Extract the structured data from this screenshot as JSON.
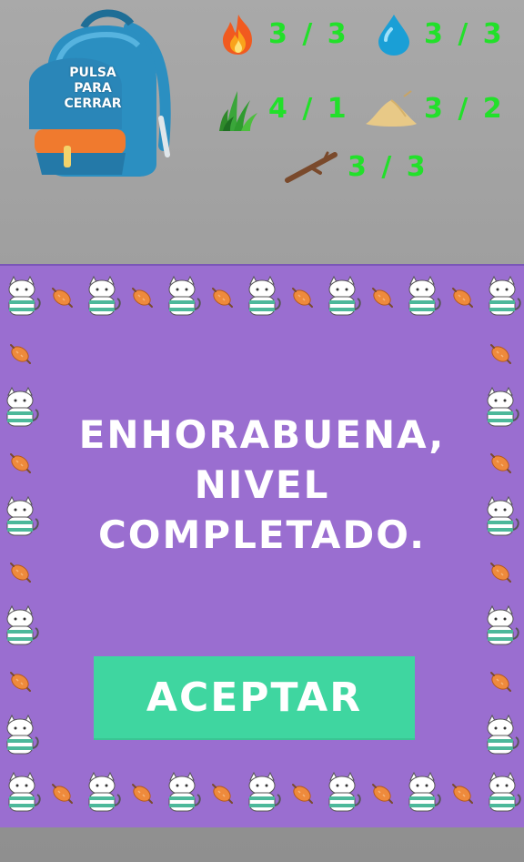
{
  "colors": {
    "panel": "#9a6ed0",
    "counter_text": "#22e02a",
    "accept_button": "#3fd6a0",
    "backpack_blue": "#2b8fc1",
    "backpack_orange": "#f07a2e"
  },
  "backpack": {
    "label": "PULSA\nPARA\nCERRAR",
    "icon": "backpack-icon"
  },
  "resources": [
    {
      "id": "fire",
      "icon": "fire-icon",
      "count": "3 / 3"
    },
    {
      "id": "water",
      "icon": "water-drop-icon",
      "count": "3 / 3"
    },
    {
      "id": "grass",
      "icon": "grass-icon",
      "count": "4 / 1"
    },
    {
      "id": "sand",
      "icon": "sand-pile-icon",
      "count": "3 / 2"
    },
    {
      "id": "stick",
      "icon": "stick-icon",
      "count": "3 / 3"
    }
  ],
  "dialog": {
    "message": "ENHORABUENA,\nNIVEL\nCOMPLETADO.",
    "accept_label": "ACEPTAR",
    "border_icons": [
      "striped-cat-icon",
      "sausage-treat-icon"
    ]
  }
}
